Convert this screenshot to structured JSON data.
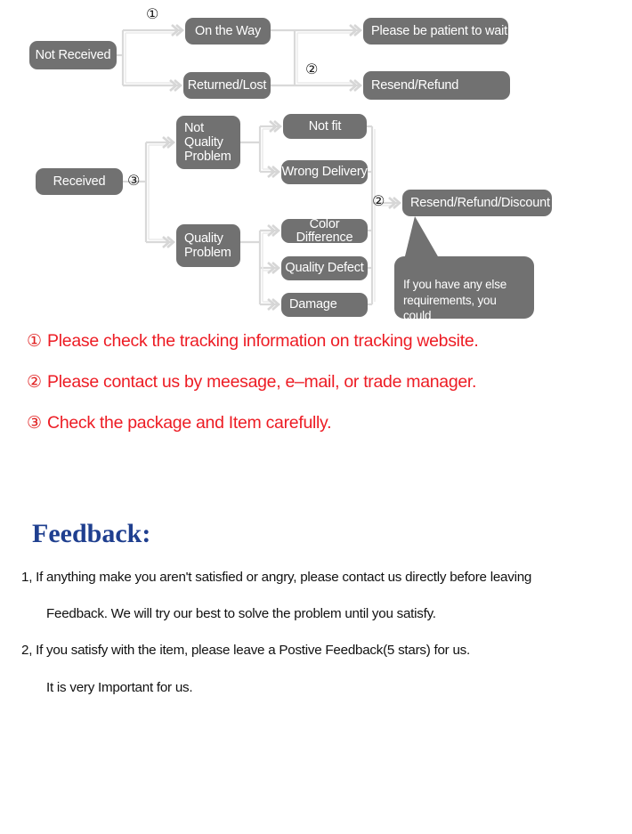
{
  "diagram": {
    "title": "after-sales-troubleshooting-flow",
    "node_color": "#717171",
    "connector_color": "#d9d9d9",
    "nodes": {
      "not_received": "Not Received",
      "on_the_way": "On the Way",
      "returned_lost": "Returned/Lost",
      "please_wait": "Please be patient to wait",
      "resend_refund": "Resend/Refund",
      "received": "Received",
      "not_quality_problem": "Not\nQuality\nProblem",
      "quality_problem": "Quality\nProblem",
      "not_fit": "Not fit",
      "wrong_delivery": "Wrong Delivery",
      "color_difference": "Color Difference",
      "quality_defect": "Quality Defect",
      "damage": "Damage",
      "resend_refund_discount": "Resend/Refund/Discount",
      "callout": "If you have any else\nrequirements, you could\nalso tell us!"
    },
    "markers": {
      "top_one": "①",
      "top_two": "②",
      "received_three": "③",
      "bottom_two": "②"
    }
  },
  "notes": {
    "color": "#ed1c24",
    "items": [
      {
        "num": "①",
        "text": "Please check the tracking information on tracking website."
      },
      {
        "num": "②",
        "text": "Please contact us by meesage, e–mail, or trade manager."
      },
      {
        "num": "③",
        "text": "Check the package and Item carefully."
      }
    ]
  },
  "feedback": {
    "title": "Feedback:",
    "title_color": "#1f3f8f",
    "lines": [
      "1, If anything make you aren't satisfied or angry, please contact us directly before leaving",
      "Feedback. We will try our best to solve the problem until you satisfy.",
      "2, If you satisfy with the item, please leave a Postive Feedback(5 stars) for us.",
      "It is very Important for us."
    ]
  }
}
